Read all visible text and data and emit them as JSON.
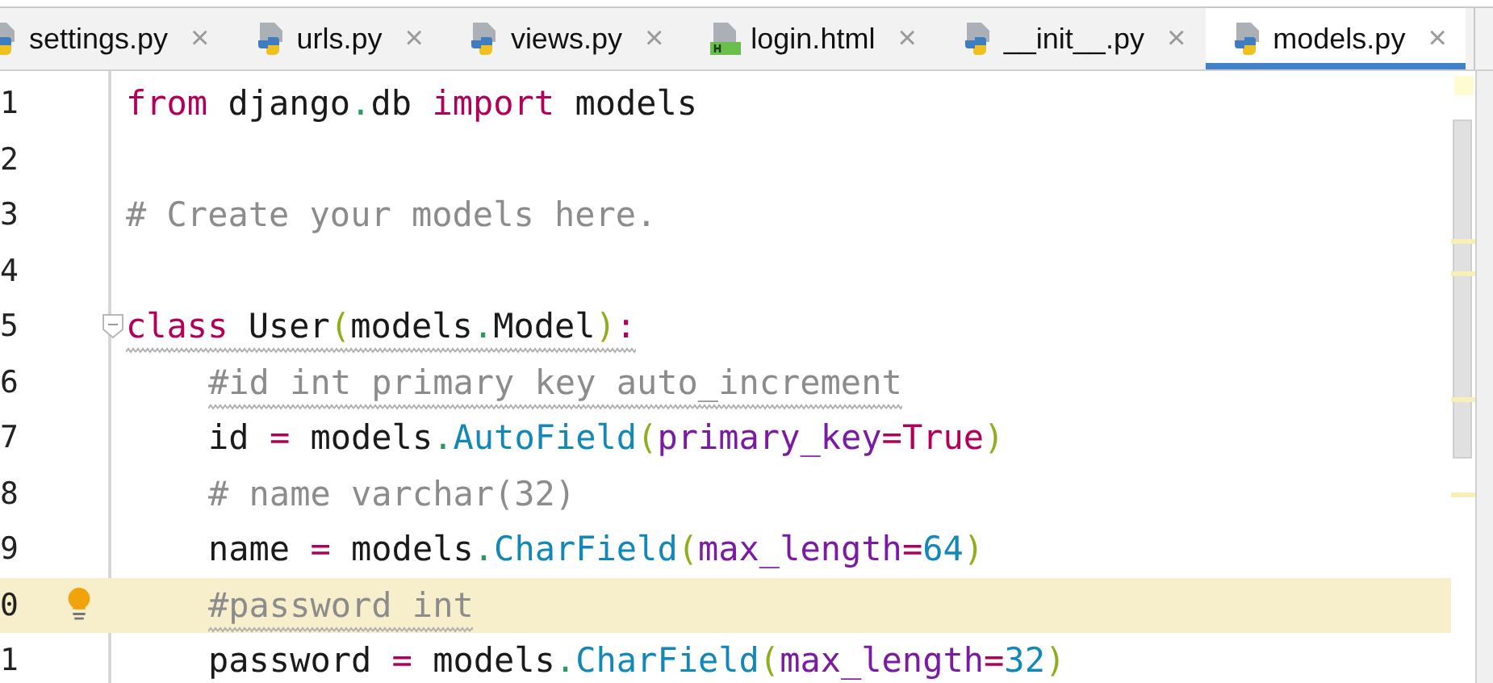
{
  "tabs": [
    {
      "label": "settings.py",
      "kind": "python",
      "selected": false,
      "close": "×"
    },
    {
      "label": "urls.py",
      "kind": "python",
      "selected": false,
      "close": "×"
    },
    {
      "label": "views.py",
      "kind": "python",
      "selected": false,
      "close": "×"
    },
    {
      "label": "login.html",
      "kind": "html",
      "selected": false,
      "close": "×"
    },
    {
      "label": "__init__.py",
      "kind": "python",
      "selected": false,
      "close": "×"
    },
    {
      "label": "models.py",
      "kind": "python",
      "selected": true,
      "close": "×"
    }
  ],
  "editor": {
    "lines": [
      {
        "number": "1",
        "tokens": [
          {
            "kind": "keyword",
            "text": "from"
          },
          {
            "kind": "plain",
            "text": " django"
          },
          {
            "kind": "dot",
            "text": "."
          },
          {
            "kind": "plain",
            "text": "db "
          },
          {
            "kind": "keyword",
            "text": "import"
          },
          {
            "kind": "plain",
            "text": " models"
          }
        ]
      },
      {
        "number": "2"
      },
      {
        "number": "3",
        "tokens": [
          {
            "kind": "comment",
            "text": "# Create your models here."
          }
        ]
      },
      {
        "number": "4"
      },
      {
        "number": "5",
        "warning": true,
        "tokens": [
          {
            "kind": "keyword",
            "text": "class"
          },
          {
            "kind": "plain",
            "text": " User"
          },
          {
            "kind": "paren",
            "text": "("
          },
          {
            "kind": "plain",
            "text": "models"
          },
          {
            "kind": "dot",
            "text": "."
          },
          {
            "kind": "plain",
            "text": "Model"
          },
          {
            "kind": "paren",
            "text": ")"
          },
          {
            "kind": "colon",
            "text": ":"
          }
        ],
        "children": [
          {
            "number": "6",
            "warning": true,
            "tokens": [
              {
                "kind": "comment",
                "text": "#id int primary key auto_increment"
              }
            ]
          },
          {
            "number": "7",
            "tokens": [
              {
                "kind": "plain",
                "text": "id "
              },
              {
                "kind": "op",
                "text": "="
              },
              {
                "kind": "plain",
                "text": " models"
              },
              {
                "kind": "dot",
                "text": "."
              },
              {
                "kind": "func",
                "text": "AutoField"
              },
              {
                "kind": "paren",
                "text": "("
              },
              {
                "kind": "param",
                "text": "primary_key"
              },
              {
                "kind": "op",
                "text": "="
              },
              {
                "kind": "keyword",
                "text": "True"
              },
              {
                "kind": "paren",
                "text": ")"
              }
            ]
          },
          {
            "number": "8",
            "tokens": [
              {
                "kind": "comment",
                "text": "# name varchar(32)"
              }
            ]
          },
          {
            "number": "9",
            "tokens": [
              {
                "kind": "plain",
                "text": "name "
              },
              {
                "kind": "op",
                "text": "="
              },
              {
                "kind": "plain",
                "text": " models"
              },
              {
                "kind": "dot",
                "text": "."
              },
              {
                "kind": "func",
                "text": "CharField"
              },
              {
                "kind": "paren",
                "text": "("
              },
              {
                "kind": "param",
                "text": "max_length"
              },
              {
                "kind": "op",
                "text": "="
              },
              {
                "kind": "number",
                "text": "64"
              },
              {
                "kind": "paren",
                "text": ")"
              }
            ]
          },
          {
            "number": "0",
            "current": true,
            "warning": true,
            "bulb": true,
            "tokens": [
              {
                "kind": "comment",
                "text": "#password int"
              }
            ]
          },
          {
            "number": "1",
            "tokens": [
              {
                "kind": "plain",
                "text": "password "
              },
              {
                "kind": "op",
                "text": "="
              },
              {
                "kind": "plain",
                "text": " models"
              },
              {
                "kind": "dot",
                "text": "."
              },
              {
                "kind": "func",
                "text": "CharField"
              },
              {
                "kind": "paren",
                "text": "("
              },
              {
                "kind": "param",
                "text": "max_length"
              },
              {
                "kind": "op",
                "text": "="
              },
              {
                "kind": "number",
                "text": "32"
              },
              {
                "kind": "paren",
                "text": ")"
              }
            ]
          }
        ]
      }
    ]
  }
}
